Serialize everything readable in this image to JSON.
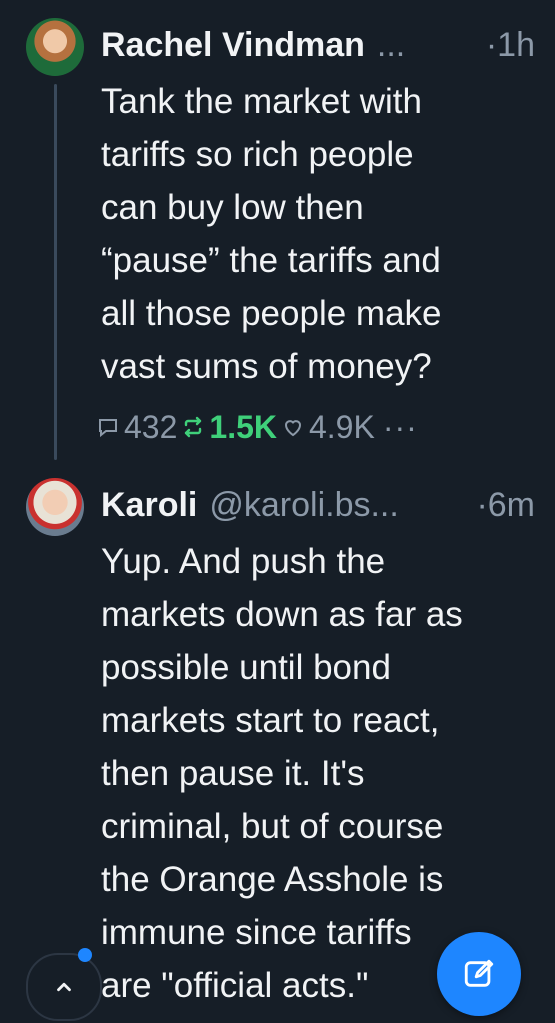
{
  "thread": [
    {
      "author_name": "Rachel Vindman",
      "handle": "...",
      "separator": "·",
      "time": "1h",
      "lines": [
        "Tank the market with",
        "tariffs so rich people",
        "can buy low then",
        "“pause” the tariffs and",
        "all those people make",
        "vast sums of money?"
      ],
      "stats": {
        "replies": "432",
        "reposts": "1.5K",
        "likes": "4.9K",
        "more": "···"
      }
    },
    {
      "author_name": "Karoli",
      "handle": "@karoli.bs...",
      "separator": "·",
      "time": "6m",
      "lines": [
        "Yup. And push the",
        "markets down as far as",
        "possible until bond",
        "markets start to react,",
        "then pause it. It's",
        "criminal, but of course",
        "the Orange Asshole is",
        "immune since tariffs",
        "are \"official acts.\""
      ]
    }
  ],
  "colors": {
    "background": "#161e27",
    "accent": "#1e86ff",
    "repost_active": "#3fd07a",
    "muted": "#8c99a8"
  },
  "icons": {
    "reply": "speech-bubble-icon",
    "repost": "repost-arrows-icon",
    "like": "heart-icon",
    "scroll_top": "chevron-up-icon",
    "compose": "compose-icon"
  }
}
